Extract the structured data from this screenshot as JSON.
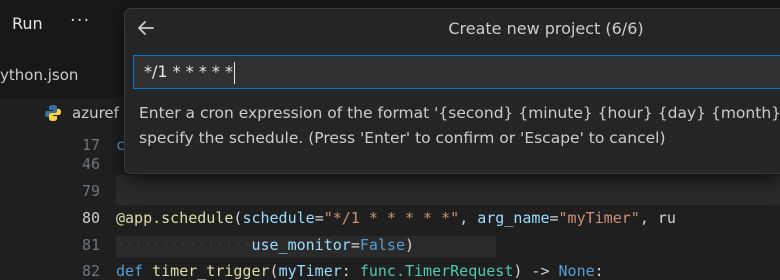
{
  "menubar": {
    "run_label": "Run",
    "more_label": "···"
  },
  "tabbar": {
    "file_tab": "ython.json"
  },
  "breadcrumb": {
    "file": "azuref"
  },
  "editor": {
    "gutter": [
      "17",
      "46",
      "79",
      "80",
      "81",
      "82"
    ],
    "line80": {
      "decorator": "@app.schedule",
      "p1": "(",
      "arg1": "schedule",
      "eq1": "=",
      "val1": "\"*/1 * * * * *\"",
      "comma": ", ",
      "arg2": "arg_name",
      "eq2": "=",
      "val2": "\"myTimer\"",
      "tail": ", ru"
    },
    "line81": {
      "dots": "···············",
      "arg": "use_monitor",
      "eq": "=",
      "val": "False",
      "close": ")"
    },
    "line82": {
      "def": "def",
      "name": "timer_trigger",
      "p": "(",
      "arg": "myTimer",
      "colon": ": ",
      "type": "func.TimerRequest",
      "arrow": ") -> ",
      "ret": "None",
      "end": ":"
    },
    "line17_partial": "c"
  },
  "quick_input": {
    "title": "Create new project (6/6)",
    "value": "*/1 * * * * *",
    "message_line1": "Enter a cron expression of the format '{second} {minute} {hour} {day} {month} {d",
    "message_line2": "specify the schedule. (Press 'Enter' to confirm or 'Escape' to cancel)"
  },
  "colors": {
    "accent": "#0078d4",
    "python_icon_blue": "#3572a5",
    "python_icon_yellow": "#ffd43b"
  }
}
